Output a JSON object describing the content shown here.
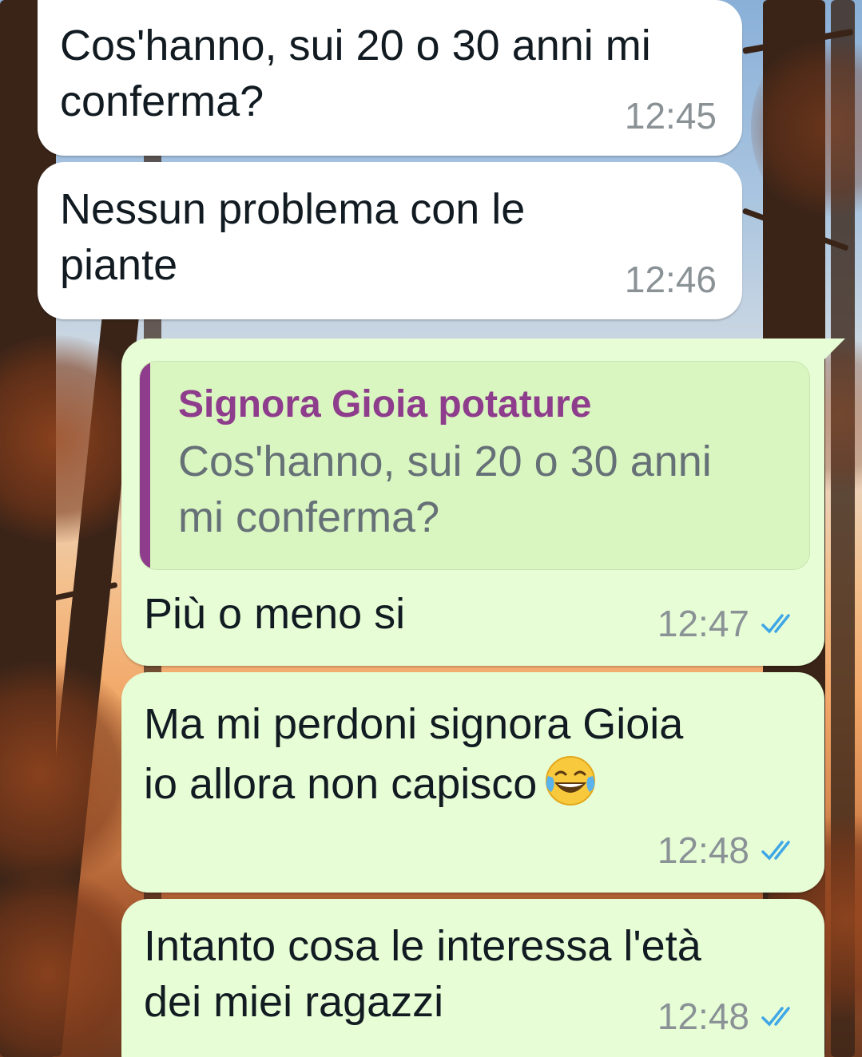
{
  "theme": {
    "incoming_bg": "#ffffff",
    "outgoing_bg": "#e7fdd6",
    "quote_accent": "#8e3d8c",
    "read_tick_color": "#3fa7e6"
  },
  "messages": [
    {
      "direction": "incoming",
      "text": "Cos'hanno, sui 20 o 30 anni mi\nconferma?",
      "time": "12:45"
    },
    {
      "direction": "incoming",
      "text": "Nessun problema con le\npiante",
      "time": "12:46"
    },
    {
      "direction": "outgoing",
      "reply_to": {
        "author": "Signora Gioia potature",
        "text": "Cos'hanno, sui 20 o 30 anni\nmi conferma?"
      },
      "text": "Più o meno si",
      "time": "12:47",
      "status": "read-double-tick"
    },
    {
      "direction": "outgoing",
      "text": "Ma mi perdoni signora Gioia\nio allora non capisco",
      "emoji": "face-with-tears-of-joy",
      "time": "12:48",
      "status": "read-double-tick"
    },
    {
      "direction": "outgoing",
      "text": "Intanto cosa le interessa l'età\ndei miei ragazzi",
      "time": "12:48",
      "status": "read-double-tick"
    }
  ]
}
